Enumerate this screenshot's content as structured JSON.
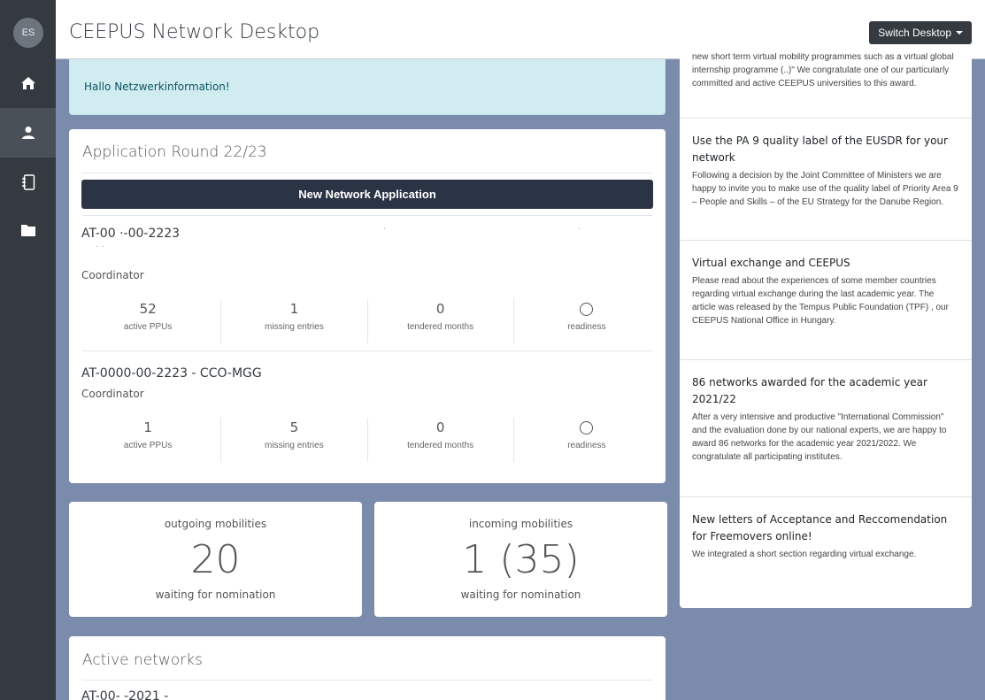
{
  "sidebar": {
    "avatar_initials": "ES",
    "items": [
      {
        "icon": "home-icon"
      },
      {
        "icon": "user-icon",
        "active": true
      },
      {
        "icon": "notebook-icon"
      },
      {
        "icon": "folder-icon"
      }
    ]
  },
  "header": {
    "title": "CEEPUS Network Desktop",
    "switch_label": "Switch Desktop"
  },
  "alert": {
    "text": "Hallo Netzwerkinformation!"
  },
  "application_round": {
    "title": "Application Round 22/23",
    "new_button": "New Network Application",
    "networks": [
      {
        "id": "AT-00 ·-00-2223",
        "role": "Coordinator",
        "stats": [
          {
            "value": "52",
            "label": "active PPUs"
          },
          {
            "value": "1",
            "label": "missing entries"
          },
          {
            "value": "0",
            "label": "tendered months"
          },
          {
            "value": "",
            "label": "readiness"
          }
        ]
      },
      {
        "id": "AT-0000-00-2223 - CCO-MGG",
        "role": "Coordinator",
        "stats": [
          {
            "value": "1",
            "label": "active PPUs"
          },
          {
            "value": "5",
            "label": "missing entries"
          },
          {
            "value": "0",
            "label": "tendered months"
          },
          {
            "value": "",
            "label": "readiness"
          }
        ]
      }
    ]
  },
  "mobilities": {
    "outgoing": {
      "label": "outgoing mobilities",
      "count": "20",
      "sub": "waiting for nomination"
    },
    "incoming": {
      "label": "incoming mobilities",
      "count": "1 (35)",
      "sub": "waiting for nomination"
    }
  },
  "active_networks": {
    "title": "Active networks",
    "first_row": "AT-00-       -2021 -"
  },
  "news": [
    {
      "title": "",
      "text": "new short term virtual mobility programmes such as a virtual global internship programme (..)\" We congratulate one of our particularly committed and active CEEPUS universities to this award."
    },
    {
      "title": "Use the PA 9 quality label of the EUSDR for your network",
      "text": "Following a decision by the Joint Committee of Ministers we are happy to invite you to make use of the quality label of Priority Area 9 – People and Skills – of the EU Strategy for the Danube Region."
    },
    {
      "title": "Virtual exchange and CEEPUS",
      "text": "Please read about the experiences of some member countries regarding virtual exchange during the last academic year. The article was released by the Tempus Public Foundation (TPF) , our CEEPUS National Office in Hungary."
    },
    {
      "title": "86 networks awarded for the academic year 2021/22",
      "text": "After a very intensive and productive \"International Commission\" and the evaluation done by our national experts, we are happy to award 86 networks for the academic year 2021/2022. We congratulate all participating institutes."
    },
    {
      "title": "New letters of Acceptance and Reccomendation for Freemovers online!",
      "text": "We integrated a short section regarding virtual exchange."
    }
  ]
}
